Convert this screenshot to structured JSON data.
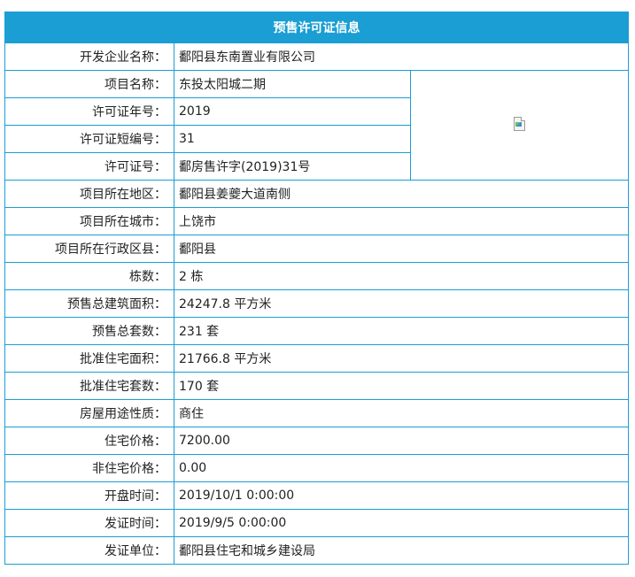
{
  "header": {
    "title": "预售许可证信息"
  },
  "rows": [
    {
      "label": "开发企业名称：",
      "value": "鄱阳县东南置业有限公司"
    },
    {
      "label": "项目名称：",
      "value": "东投太阳城二期"
    },
    {
      "label": "许可证年号：",
      "value": "2019"
    },
    {
      "label": "许可证短编号：",
      "value": "31"
    },
    {
      "label": "许可证号：",
      "value": "鄱房售许字(2019)31号"
    },
    {
      "label": "项目所在地区：",
      "value": "鄱阳县姜夔大道南侧"
    },
    {
      "label": "项目所在城市：",
      "value": "上饶市"
    },
    {
      "label": "项目所在行政区县：",
      "value": "鄱阳县"
    },
    {
      "label": "栋数：",
      "value": "2 栋"
    },
    {
      "label": "预售总建筑面积：",
      "value": "24247.8 平方米"
    },
    {
      "label": "预售总套数：",
      "value": "231 套"
    },
    {
      "label": "批准住宅面积：",
      "value": "21766.8 平方米"
    },
    {
      "label": "批准住宅套数：",
      "value": "170 套"
    },
    {
      "label": "房屋用途性质：",
      "value": "商住"
    },
    {
      "label": "住宅价格：",
      "value": "7200.00"
    },
    {
      "label": "非住宅价格：",
      "value": "0.00"
    },
    {
      "label": "开盘时间：",
      "value": "2019/10/1 0:00:00"
    },
    {
      "label": "发证时间：",
      "value": "2019/9/5 0:00:00"
    },
    {
      "label": "发证单位：",
      "value": "鄱阳县住宅和城乡建设局"
    }
  ],
  "image": {
    "icon": "broken-image-icon"
  },
  "colors": {
    "accent": "#1a9ed3"
  }
}
